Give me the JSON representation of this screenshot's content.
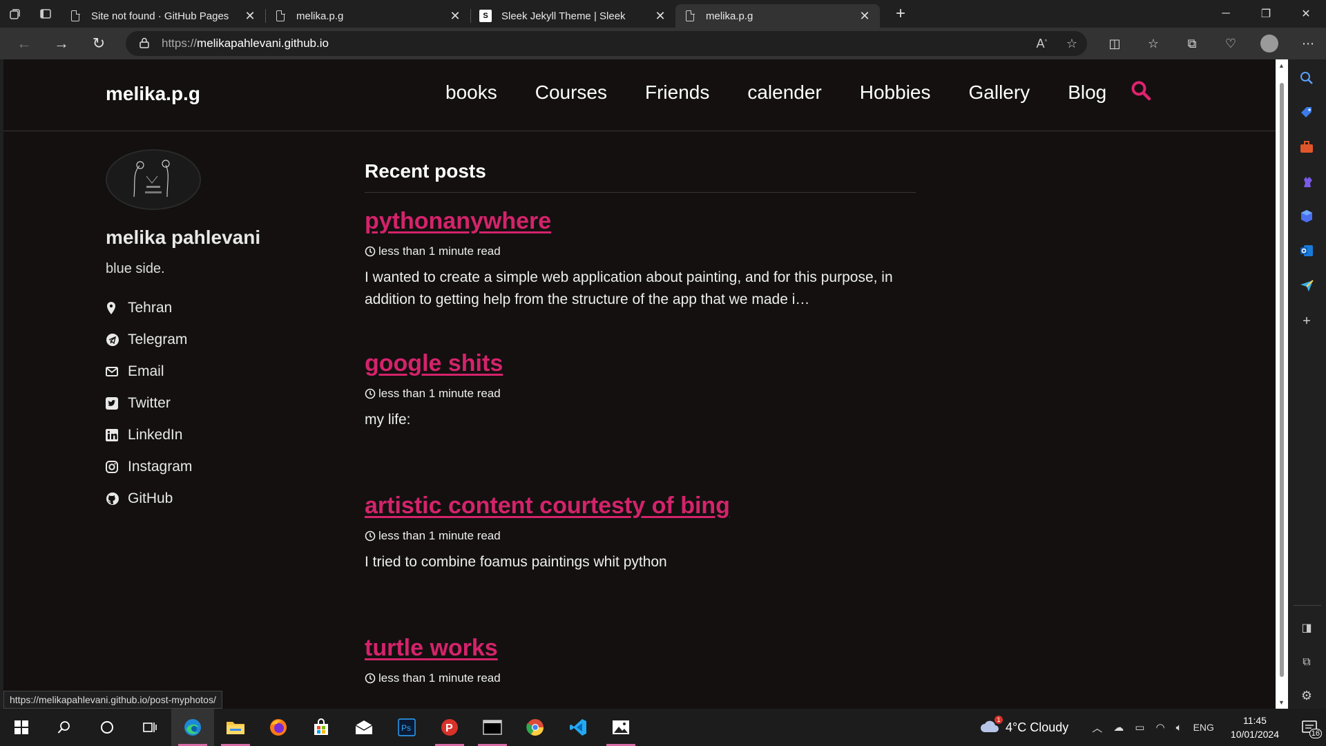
{
  "browser": {
    "tabs": [
      {
        "title": "Site not found · GitHub Pages",
        "favicon": "page-icon",
        "active": false
      },
      {
        "title": "melika.p.g",
        "favicon": "page-icon",
        "active": false
      },
      {
        "title": "Sleek Jekyll Theme | Sleek",
        "favicon": "sleek-favicon",
        "favicon_letter": "S",
        "active": false
      },
      {
        "title": "melika.p.g",
        "favicon": "page-icon",
        "active": true
      }
    ],
    "url_protocol": "https://",
    "url_host": "melikapahlevani.github.io",
    "status_url": "https://melikapahlevani.github.io/post-myphotos/"
  },
  "site": {
    "brand": "melika.p.g",
    "nav": [
      "books",
      "Courses",
      "Friends",
      "calender",
      "Hobbies",
      "Gallery",
      "Blog"
    ],
    "accent": "#d4236b"
  },
  "author": {
    "name": "melika pahlevani",
    "bio": "blue side.",
    "links": [
      {
        "label": "Tehran",
        "icon": "map-pin-icon"
      },
      {
        "label": "Telegram",
        "icon": "telegram-icon"
      },
      {
        "label": "Email",
        "icon": "envelope-icon"
      },
      {
        "label": "Twitter",
        "icon": "twitter-icon"
      },
      {
        "label": "LinkedIn",
        "icon": "linkedin-icon"
      },
      {
        "label": "Instagram",
        "icon": "instagram-icon"
      },
      {
        "label": "GitHub",
        "icon": "github-icon"
      }
    ]
  },
  "main": {
    "heading": "Recent posts",
    "posts": [
      {
        "title": "pythonanywhere",
        "read_time": "less than 1 minute read",
        "excerpt": "I wanted to create a simple web application about painting, and for this purpose, in addition to getting help from the structure of the app that we made i…"
      },
      {
        "title": "google shits",
        "read_time": "less than 1 minute read",
        "excerpt": "my life:"
      },
      {
        "title": "artistic content courtesty of bing",
        "read_time": "less than 1 minute read",
        "excerpt": "I tried to combine foamus paintings whit python"
      },
      {
        "title": "turtle works",
        "read_time": "less than 1 minute read",
        "excerpt": ""
      }
    ]
  },
  "taskbar": {
    "weather": "4°C  Cloudy",
    "weather_badge": "1",
    "language": "ENG",
    "time": "11:45",
    "date": "10/01/2024",
    "notification_count": "16"
  }
}
